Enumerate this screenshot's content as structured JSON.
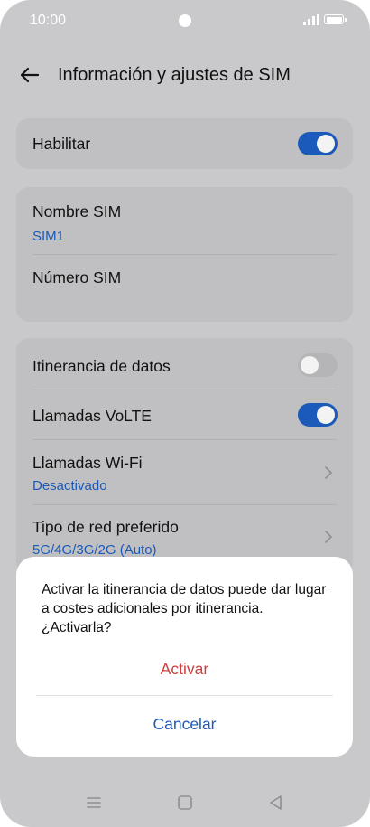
{
  "status_bar": {
    "time": "10:00",
    "icons": [
      "camera-dot",
      "signal-icon",
      "battery-icon"
    ]
  },
  "header": {
    "title": "Información y ajustes de SIM",
    "back_icon": "arrow-left-icon"
  },
  "section_enable": {
    "label": "Habilitar",
    "toggle_on": true
  },
  "section_sim": {
    "name_label": "Nombre SIM",
    "name_value": "SIM1",
    "number_label": "Número SIM"
  },
  "section_network": {
    "roaming_label": "Itinerancia de datos",
    "roaming_on": false,
    "volte_label": "Llamadas VoLTE",
    "volte_on": true,
    "wifi_calls_label": "Llamadas Wi-Fi",
    "wifi_calls_value": "Desactivado",
    "network_type_label": "Tipo de red preferido",
    "network_type_value": "5G/4G/3G/2G (Auto)"
  },
  "dialog": {
    "message": "Activar la itinerancia de datos puede dar lugar a costes adicionales por itinerancia. ¿Activarla?",
    "confirm_label": "Activar",
    "cancel_label": "Cancelar"
  },
  "nav_bar": {
    "icons": [
      "menu-icon",
      "home-icon",
      "back-triangle-icon"
    ]
  },
  "colors": {
    "accent": "#1b5ab8",
    "danger": "#cf3e3e",
    "scrim_background": "#c9c9cb",
    "card_background": "#c0c0c2",
    "dialog_background": "#ffffff"
  }
}
